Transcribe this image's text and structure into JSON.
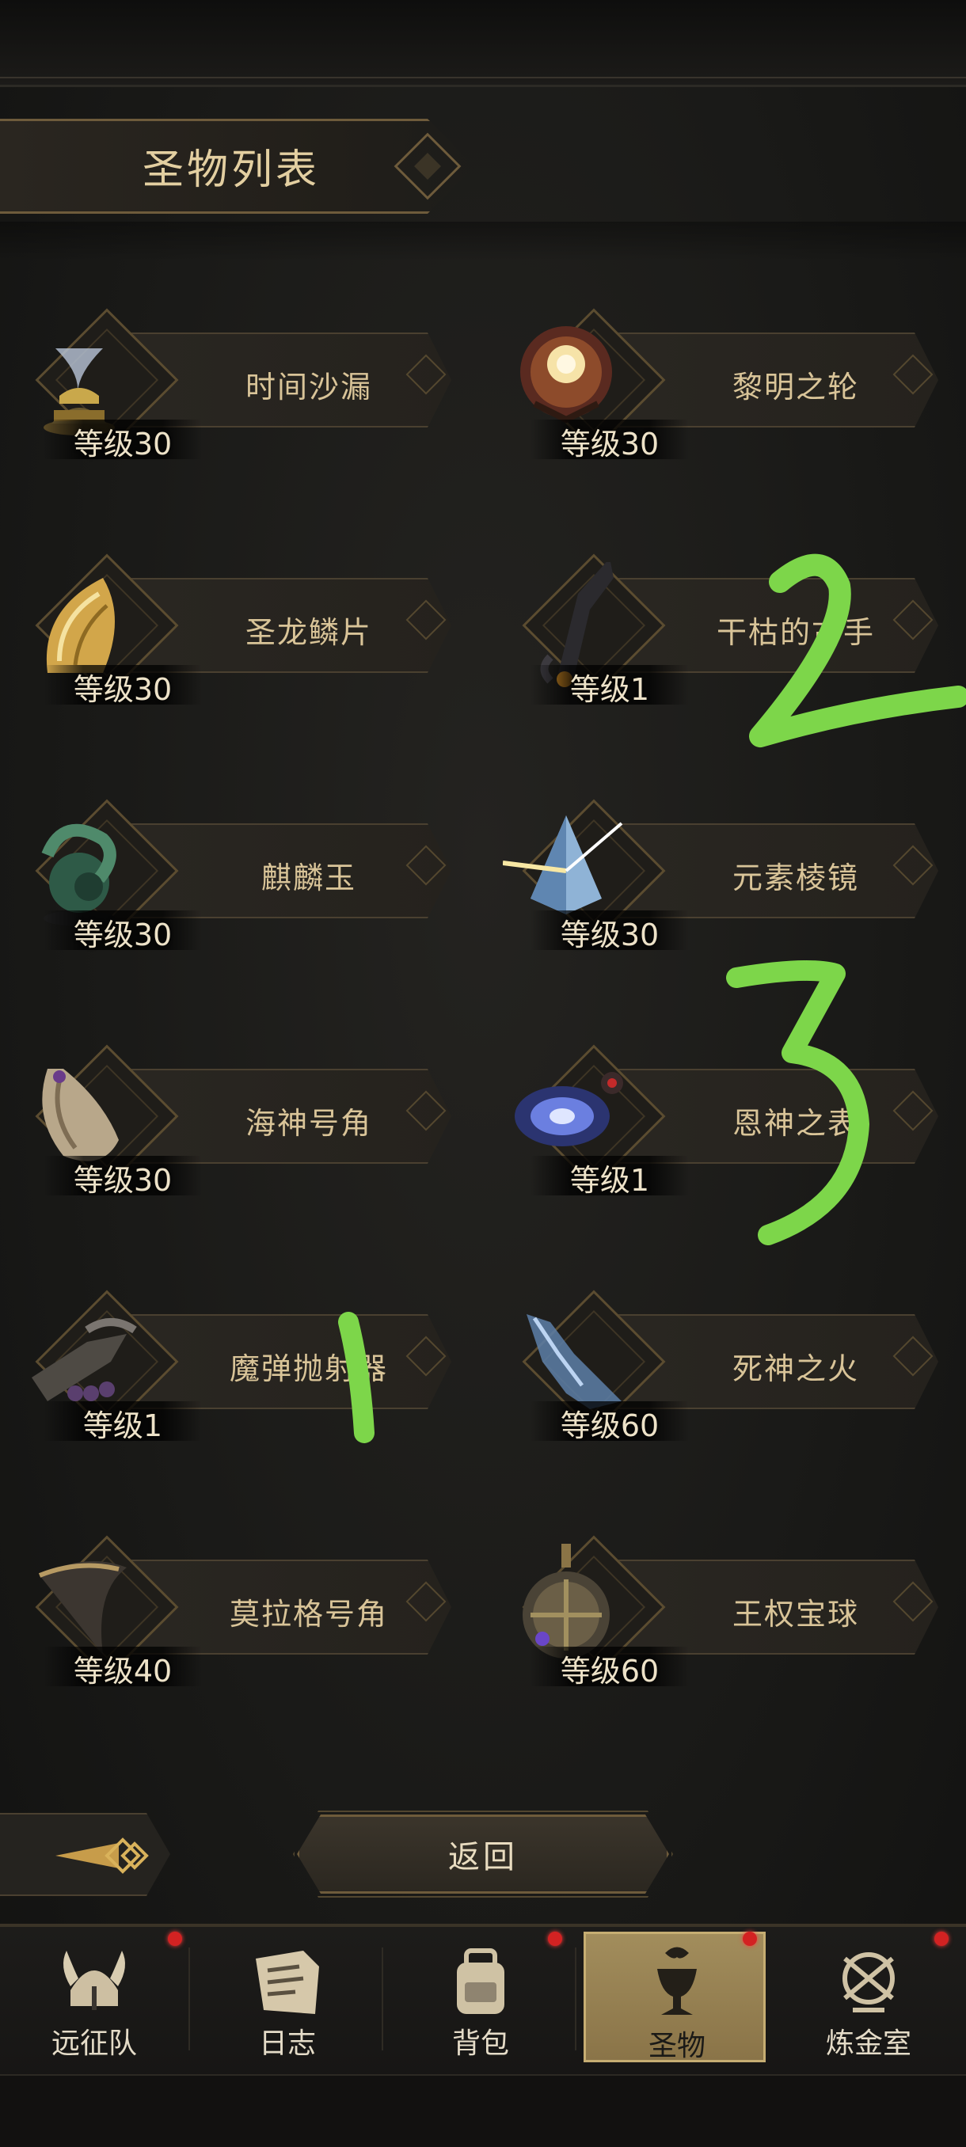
{
  "header": {
    "title": "圣物列表"
  },
  "relics": [
    {
      "name": "时间沙漏",
      "level": "等级30",
      "icon": "hourglass-icon"
    },
    {
      "name": "黎明之轮",
      "level": "等级30",
      "icon": "dawn-wheel-icon"
    },
    {
      "name": "圣龙鳞片",
      "level": "等级30",
      "icon": "dragon-scale-icon"
    },
    {
      "name": "干枯的古手",
      "level": "等级1",
      "icon": "withered-hand-icon"
    },
    {
      "name": "麒麟玉",
      "level": "等级30",
      "icon": "jade-dragon-icon"
    },
    {
      "name": "元素棱镜",
      "level": "等级30",
      "icon": "prism-icon"
    },
    {
      "name": "海神号角",
      "level": "等级30",
      "icon": "conch-horn-icon"
    },
    {
      "name": "恩神之表",
      "level": "等级1",
      "icon": "vortex-watch-icon"
    },
    {
      "name": "魔弹抛射器",
      "level": "等级1",
      "icon": "launcher-icon"
    },
    {
      "name": "死神之火",
      "level": "等级60",
      "icon": "ghost-hand-icon"
    },
    {
      "name": "莫拉格号角",
      "level": "等级40",
      "icon": "horn-icon"
    },
    {
      "name": "王权宝球",
      "level": "等级60",
      "icon": "orb-icon"
    }
  ],
  "back": {
    "label": "返回"
  },
  "nav": [
    {
      "label": "远征队",
      "icon": "viking-helmet-icon",
      "badge": true
    },
    {
      "label": "日志",
      "icon": "scroll-map-icon",
      "badge": false
    },
    {
      "label": "背包",
      "icon": "backpack-icon",
      "badge": true
    },
    {
      "label": "圣物",
      "icon": "chalice-icon",
      "badge": true,
      "active": true
    },
    {
      "label": "炼金室",
      "icon": "alchemy-icon",
      "badge": true
    }
  ],
  "annotations": [
    "2",
    "3",
    "1"
  ],
  "colors": {
    "accent": "#6e5b3b",
    "active_tab": "#a28d5c",
    "badge": "#d32222",
    "scribble": "#7dd64a"
  }
}
